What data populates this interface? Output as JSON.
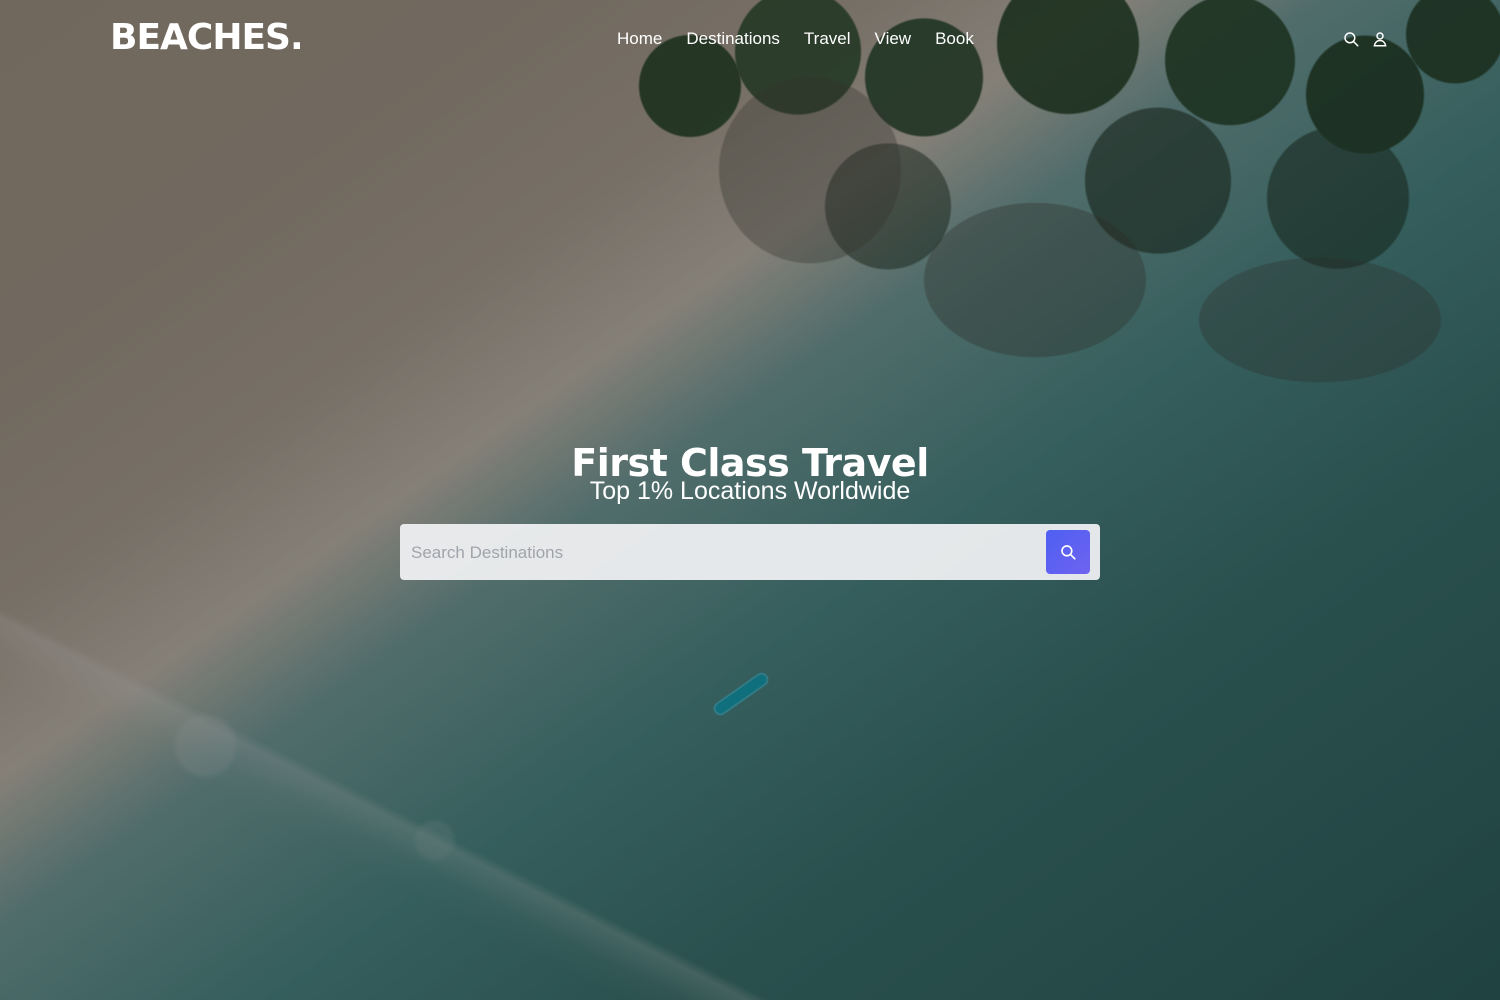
{
  "brand": {
    "logo_text": "BEACHES."
  },
  "nav": {
    "items": [
      {
        "label": "Home"
      },
      {
        "label": "Destinations"
      },
      {
        "label": "Travel"
      },
      {
        "label": "View"
      },
      {
        "label": "Book"
      }
    ],
    "icons": [
      {
        "name": "search-icon"
      },
      {
        "name": "user-icon"
      }
    ]
  },
  "hero": {
    "title": "First Class Travel",
    "subtitle": "Top 1% Locations Worldwide"
  },
  "search": {
    "placeholder": "Search Destinations",
    "value": "",
    "button_icon": "search-icon"
  },
  "colors": {
    "text": "#ffffff",
    "search_button": "#5b62f1",
    "search_box": "#eeeff1"
  }
}
